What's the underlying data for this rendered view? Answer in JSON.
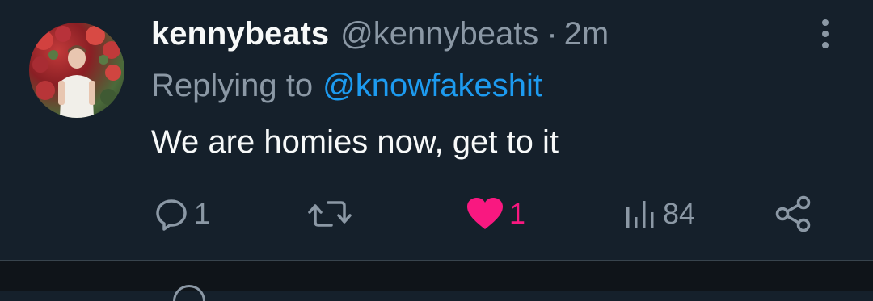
{
  "tweet": {
    "display_name": "kennybeats",
    "handle": "@kennybeats",
    "separator": "·",
    "time": "2m",
    "replying_lead": "Replying to",
    "replying_to": "@knowfakeshit",
    "text": "We are homies now, get to it"
  },
  "actions": {
    "reply_count": "1",
    "like_count": "1",
    "views_count": "84",
    "liked": true
  },
  "icons": {
    "avatar": "profile-photo",
    "more": "more-vertical-icon",
    "reply": "reply-bubble-icon",
    "retweet": "retweet-icon",
    "like": "heart-icon",
    "views": "views-chart-icon",
    "share": "share-icon"
  },
  "colors": {
    "background": "#15202b",
    "text": "#f7f9f9",
    "muted": "#8b98a5",
    "link": "#1d9bf0",
    "like": "#f91880"
  }
}
